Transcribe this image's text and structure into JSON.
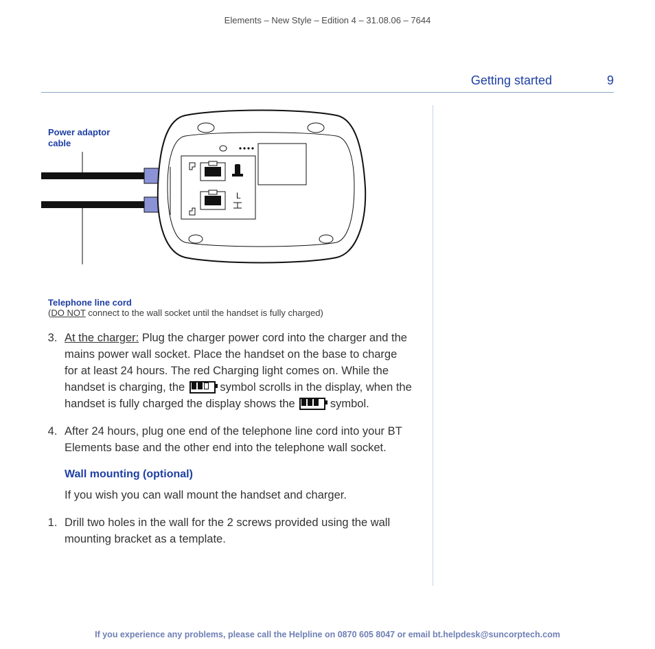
{
  "meta": {
    "line": "Elements – New Style – Edition 4 – 31.08.06 – 7644"
  },
  "header": {
    "section": "Getting started",
    "page": "9"
  },
  "diagram": {
    "power_label": "Power adaptor cable",
    "tel_label": "Telephone line cord",
    "tel_note_prefix": "(",
    "tel_note_donot": "DO NOT",
    "tel_note_rest": " connect to the wall socket until the handset is fully charged)"
  },
  "steps_a": [
    {
      "num": "3",
      "lead": "At the charger:",
      "t1": " Plug the charger power cord into the charger and the mains power wall socket. Place the handset on the base to charge for at least 24 hours. The red Charging light comes on. While the handset is charging, the ",
      "t2": " symbol scrolls in the display, when the handset is fully charged the display shows the ",
      "t3": " symbol."
    },
    {
      "num": "4",
      "text": "After 24 hours, plug one end of the telephone line cord into your BT Elements base and the other end into the telephone wall socket."
    }
  ],
  "wall": {
    "heading": "Wall mounting (optional)",
    "intro": "If you wish you can wall mount the handset and charger."
  },
  "steps_b": [
    {
      "num": "1",
      "text": "Drill two holes in the wall for the 2 screws provided using the wall mounting bracket as a template."
    }
  ],
  "footer": "If you experience any problems, please call the Helpline on 0870 605 8047 or email bt.helpdesk@suncorptech.com"
}
